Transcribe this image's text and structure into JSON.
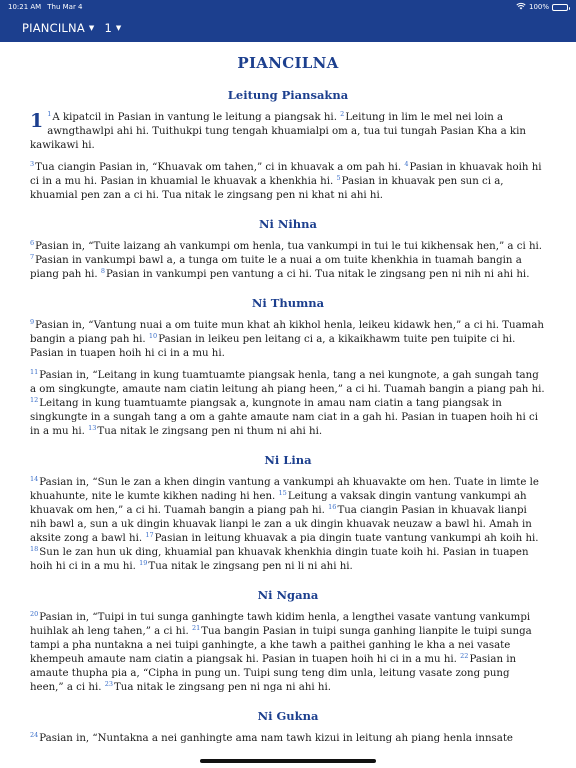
{
  "status": {
    "time": "10:21 AM",
    "date": "Thu Mar 4",
    "battery": "100%",
    "battery_level": 1.0
  },
  "nav": {
    "book": "PIANCILNA",
    "chapter": "1"
  },
  "book_title": "PIANCILNA",
  "sections": [
    {
      "heading": "Leitung Piansakna",
      "chapter": "1",
      "paragraphs": [
        [
          {
            "n": "1",
            "t": "A kipatcil in Pasian in vantung le leitung a piangsak hi. "
          },
          {
            "n": "2",
            "t": "Leitung in lim le mel nei loin a awngthawlpi ahi hi. Tuithukpi tung tengah khuamialpi om a, tua tui tungah Pasian Kha a kin kawikawi hi."
          }
        ],
        [
          {
            "n": "3",
            "t": "Tua ciangin Pasian in, “Khuavak om tahen,” ci in khuavak a om pah hi. "
          },
          {
            "n": "4",
            "t": "Pasian in khuavak hoih hi ci in a mu hi. Pasian in khuamial le khuavak a khenkhia hi. "
          },
          {
            "n": "5",
            "t": "Pasian in khuavak pen sun ci a, khuamial pen zan a ci hi. Tua nitak le zingsang pen ni khat ni ahi hi."
          }
        ]
      ]
    },
    {
      "heading": "Ni Nihna",
      "paragraphs": [
        [
          {
            "n": "6",
            "t": "Pasian in, “Tuite laizang ah vankumpi om henla, tua vankumpi in tui le tui kikhensak hen,” a ci hi. "
          },
          {
            "n": "7",
            "t": "Pasian in vankumpi bawl a, a tunga om tuite le a nuai a om tuite khenkhia in tuamah bangin a piang pah hi. "
          },
          {
            "n": "8",
            "t": "Pasian in vankumpi pen vantung a ci hi. Tua nitak le zingsang pen ni nih ni ahi hi."
          }
        ]
      ]
    },
    {
      "heading": "Ni Thumna",
      "paragraphs": [
        [
          {
            "n": "9",
            "t": "Pasian in, “Vantung nuai a om tuite mun khat ah kikhol henla, leikeu kidawk hen,” a ci hi. Tuamah bangin a piang pah hi. "
          },
          {
            "n": "10",
            "t": "Pasian in leikeu pen leitang ci a, a kikaikhawm tuite pen tuipite ci hi. Pasian in tuapen hoih hi ci in a mu hi."
          }
        ],
        [
          {
            "n": "11",
            "t": "Pasian in, “Leitang in kung tuamtuamte piangsak henla, tang a nei kungnote, a gah sungah tang a om singkungte, amaute nam ciatin leitung ah piang heen,” a ci hi. Tuamah bangin a piang pah hi. "
          },
          {
            "n": "12",
            "t": "Leitang in kung tuamtuamte piangsak a, kungnote in amau nam ciatin a tang piangsak in singkungte in a sungah tang a om a gahte amaute nam ciat in a gah hi. Pasian in tuapen hoih hi ci in a mu hi. "
          },
          {
            "n": "13",
            "t": "Tua nitak le zingsang pen ni thum ni ahi hi."
          }
        ]
      ]
    },
    {
      "heading": "Ni Lina",
      "paragraphs": [
        [
          {
            "n": "14",
            "t": "Pasian in, “Sun le zan a khen dingin vantung a vankumpi ah khuavakte om hen. Tuate in limte le khuahunte, nite le kumte kikhen nading hi hen. "
          },
          {
            "n": "15",
            "t": "Leitung a vaksak dingin vantung vankumpi ah khuavak om hen,” a ci hi. Tuamah bangin a piang pah hi. "
          },
          {
            "n": "16",
            "t": "Tua ciangin Pasian in khuavak lianpi nih bawl a, sun a uk dingin khuavak lianpi le zan a uk dingin khuavak neuzaw a bawl hi. Amah in aksite zong a bawl hi. "
          },
          {
            "n": "17",
            "t": "Pasian in leitung khuavak a pia dingin tuate vantung vankumpi ah koih hi. "
          },
          {
            "n": "18",
            "t": "Sun le zan hun uk ding, khuamial pan khuavak khenkhia dingin tuate koih hi. Pasian in tuapen hoih hi ci in a mu hi. "
          },
          {
            "n": "19",
            "t": "Tua nitak le zingsang pen ni li ni ahi hi."
          }
        ]
      ]
    },
    {
      "heading": "Ni Ngana",
      "paragraphs": [
        [
          {
            "n": "20",
            "t": "Pasian in, “Tuipi in tui sunga ganhingte tawh kidim henla, a lengthei vasate vantung vankumpi huihlak ah leng tahen,” a ci hi. "
          },
          {
            "n": "21",
            "t": "Tua bangin Pasian in tuipi sunga ganhing lianpite le tuipi sunga tampi a pha nuntakna a nei tuipi ganhingte, a khe tawh a paithei ganhing le kha a nei vasate khempeuh amaute nam ciatin a piangsak hi. Pasian in tuapen hoih hi ci in a mu hi. "
          },
          {
            "n": "22",
            "t": "Pasian in amaute thupha pia a, “Cipha in pung un. Tuipi sung teng dim unla, leitung vasate zong pung heen,” a ci hi. "
          },
          {
            "n": "23",
            "t": "Tua nitak le zingsang pen ni nga ni ahi hi."
          }
        ]
      ]
    },
    {
      "heading": "Ni Gukna",
      "paragraphs": [
        [
          {
            "n": "24",
            "t": "Pasian in, “Nuntakna a nei ganhingte ama nam tawh kizui in leitung ah piang henla innsate"
          }
        ]
      ]
    }
  ]
}
